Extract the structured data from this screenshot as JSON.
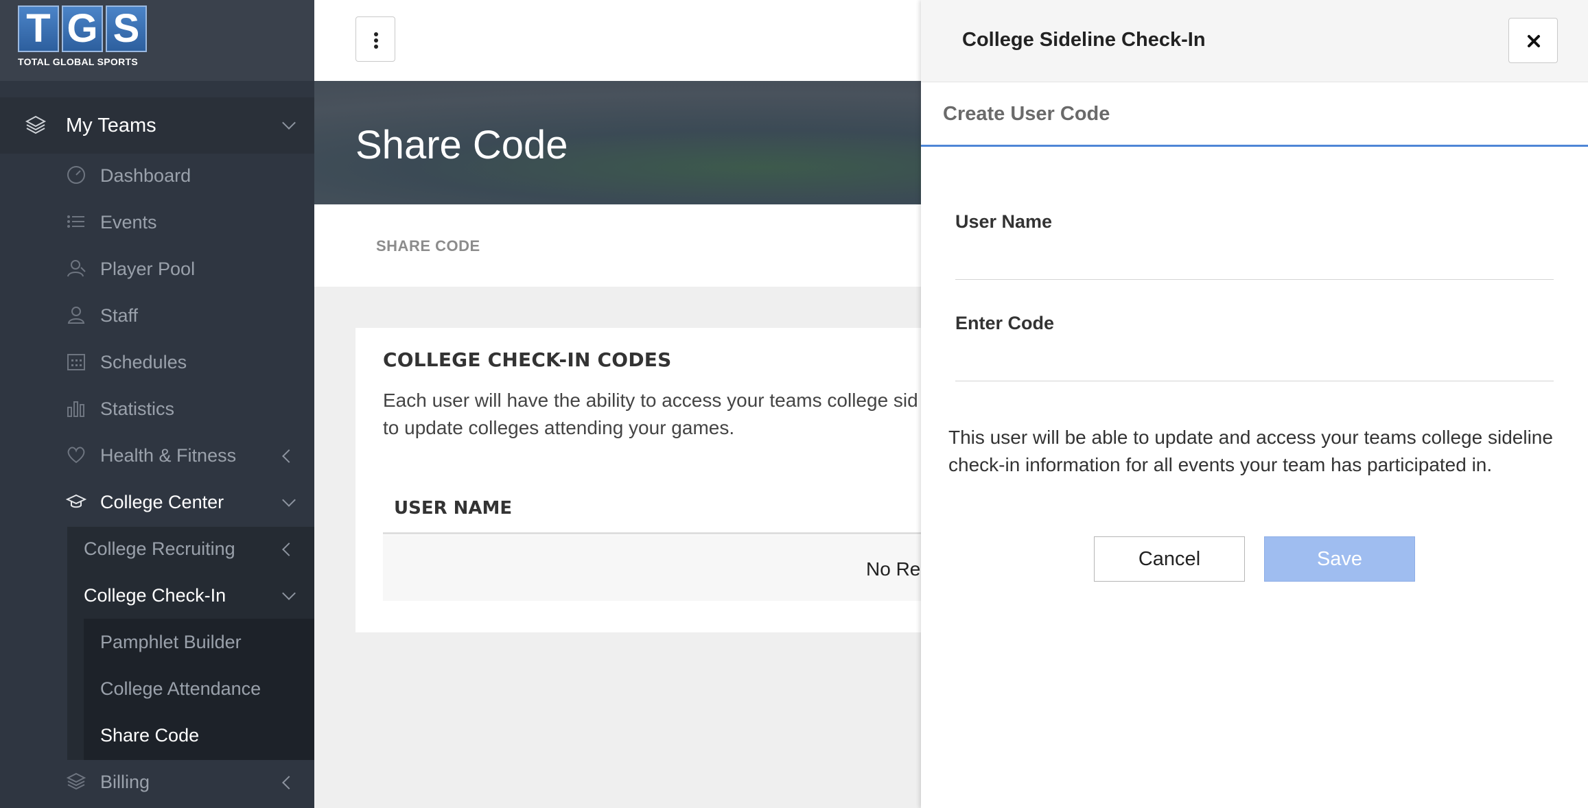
{
  "logo": {
    "letters": [
      "T",
      "G",
      "S"
    ],
    "tagline": "TOTAL GLOBAL SPORTS"
  },
  "sidebar": {
    "top": {
      "label": "My Teams",
      "icon": "layers-icon"
    },
    "items": [
      {
        "label": "Dashboard",
        "icon": "dashboard-icon"
      },
      {
        "label": "Events",
        "icon": "list-icon"
      },
      {
        "label": "Player Pool",
        "icon": "player-icon"
      },
      {
        "label": "Staff",
        "icon": "staff-icon"
      },
      {
        "label": "Schedules",
        "icon": "calendar-icon"
      },
      {
        "label": "Statistics",
        "icon": "bar-chart-icon"
      },
      {
        "label": "Health & Fitness",
        "icon": "heart-icon"
      },
      {
        "label": "College Center",
        "icon": "graduation-cap-icon"
      },
      {
        "label": "College Recruiting"
      },
      {
        "label": "College Check-In"
      },
      {
        "label": "Pamphlet Builder"
      },
      {
        "label": "College Attendance"
      },
      {
        "label": "Share Code"
      },
      {
        "label": "Billing",
        "icon": "layers-icon"
      }
    ]
  },
  "hero": {
    "title": "Share Code"
  },
  "tabs": {
    "share_code": "SHARE CODE"
  },
  "card": {
    "heading": "COLLEGE CHECK-IN CODES",
    "description": "Each user will have the ability to access your teams college sid​to update colleges attending your games.",
    "desc_line1": "Each user will have the ability to access your teams college sid",
    "desc_line2": "to update colleges attending your games.",
    "column_user_name": "USER NAME",
    "empty_text": "No Re"
  },
  "drawer": {
    "title": "College Sideline Check-In",
    "subtitle": "Create User Code",
    "user_name_label": "User Name",
    "user_name_value": "",
    "enter_code_label": "Enter Code",
    "enter_code_value": "",
    "info": "This user will be able to update and access your teams college sideline check-in information for all events your team has participated in.",
    "cancel_label": "Cancel",
    "save_label": "Save"
  },
  "colors": {
    "sidebar_bg": "#2f3641",
    "accent_blue": "#4e86d6",
    "save_disabled": "#9fbdf0"
  }
}
